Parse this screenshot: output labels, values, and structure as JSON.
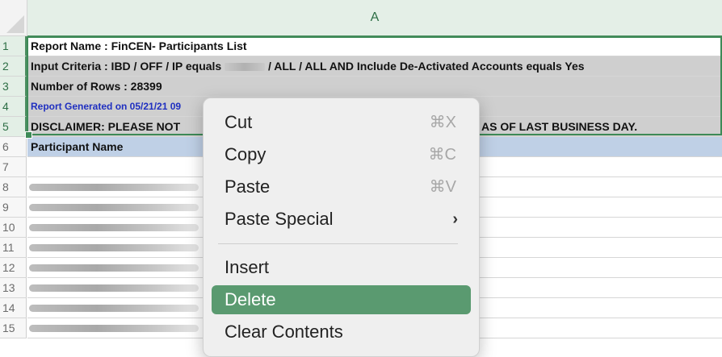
{
  "column_header": "A",
  "row_numbers": [
    "1",
    "2",
    "3",
    "4",
    "5",
    "6",
    "7",
    "8",
    "9",
    "10",
    "11",
    "12",
    "13",
    "14",
    "15"
  ],
  "rows": {
    "r1": "Report Name : FinCEN- Participants List",
    "r2_pre": "Input Criteria : IBD / OFF / IP equals",
    "r2_post": "/ ALL / ALL AND  Include De-Activated Accounts equals  Yes",
    "r3": "Number of Rows :   28399",
    "r4": "Report Generated on 05/21/21 09",
    "r5_left": "DISCLAIMER: PLEASE NOT",
    "r5_right": "AS OF LAST BUSINESS DAY.",
    "r6": "Participant Name"
  },
  "context_menu": {
    "cut": {
      "label": "Cut",
      "shortcut": "⌘X"
    },
    "copy": {
      "label": "Copy",
      "shortcut": "⌘C"
    },
    "paste": {
      "label": "Paste",
      "shortcut": "⌘V"
    },
    "paste_special": {
      "label": "Paste Special",
      "chevron": "›"
    },
    "insert": {
      "label": "Insert"
    },
    "delete": {
      "label": "Delete"
    },
    "clear_contents": {
      "label": "Clear Contents"
    }
  },
  "colors": {
    "selection": "#3d8a57",
    "menu_highlight": "#5a9a70",
    "header_row": "#bfd0e6",
    "gray_rows": "#cfcfcf"
  },
  "icons": {
    "select_all": "select-all-triangle-icon",
    "submenu": "chevron-right-icon"
  }
}
